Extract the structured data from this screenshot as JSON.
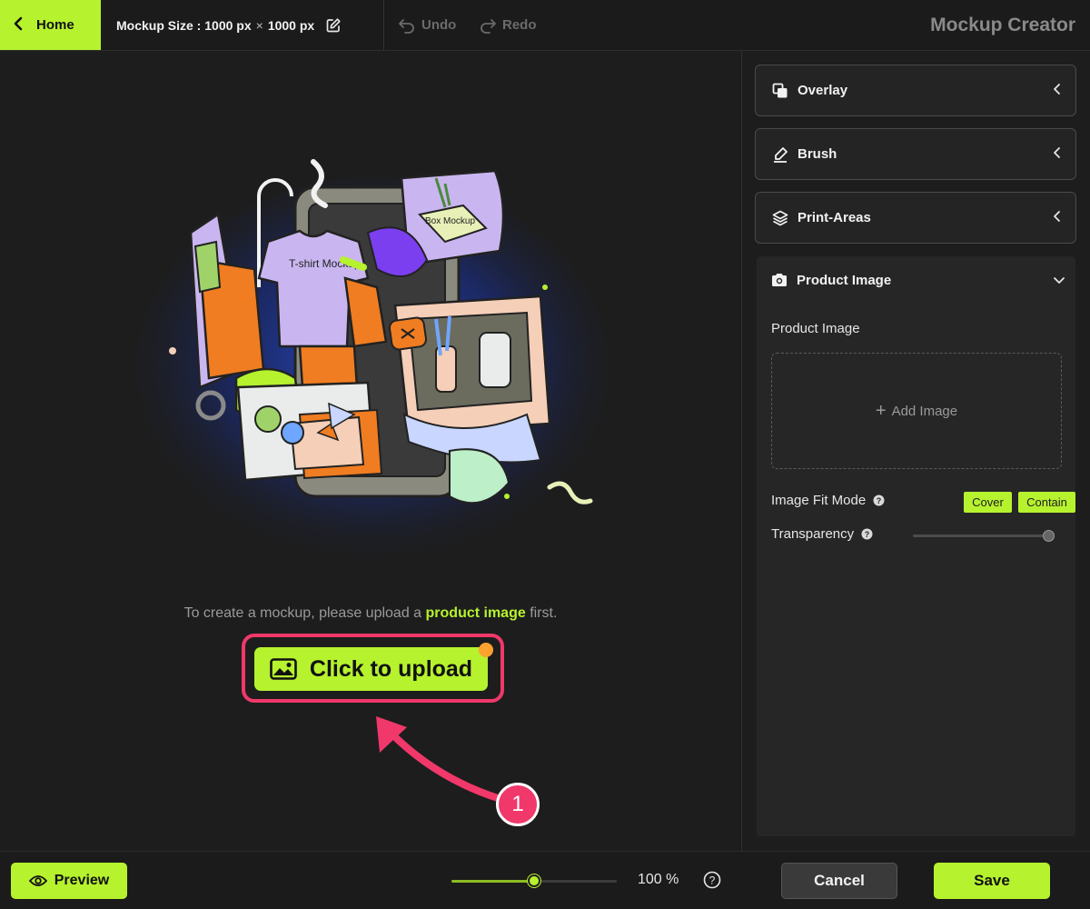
{
  "topbar": {
    "home_label": "Home",
    "mockup_size_label": "Mockup Size :",
    "width": "1000 px",
    "times": "×",
    "height": "1000 px",
    "undo_label": "Undo",
    "redo_label": "Redo",
    "app_title": "Mockup Creator"
  },
  "canvas": {
    "hint_prefix": "To create a mockup, please upload a",
    "hint_highlight": "product image",
    "hint_suffix": "first.",
    "upload_label": "Click to upload",
    "step_number": "1",
    "illustration_labels": {
      "tshirt": "T-shirt Mockup.",
      "box": "Box Mockup"
    }
  },
  "panel": {
    "sections": [
      {
        "label": "Overlay",
        "icon": "overlay-icon",
        "state": "collapsed"
      },
      {
        "label": "Brush",
        "icon": "brush-icon",
        "state": "collapsed"
      },
      {
        "label": "Print-Areas",
        "icon": "layers-icon",
        "state": "collapsed"
      },
      {
        "label": "Product Image",
        "icon": "camera-icon",
        "state": "expanded"
      }
    ],
    "product_image": {
      "title": "Product Image",
      "subtitle": "Product Image",
      "add_image_label": "Add Image",
      "fit_mode_label": "Image Fit Mode",
      "fit_options": [
        "Cover",
        "Contain"
      ],
      "transparency_label": "Transparency",
      "transparency_value": 1.0
    }
  },
  "bottombar": {
    "preview_label": "Preview",
    "zoom_value": "100 %",
    "zoom_fraction": 0.5,
    "cancel_label": "Cancel",
    "save_label": "Save"
  },
  "colors": {
    "accent": "#b6f22e",
    "highlight": "#f0386b",
    "notification": "#ffa12e",
    "background": "#1d1d1d"
  }
}
